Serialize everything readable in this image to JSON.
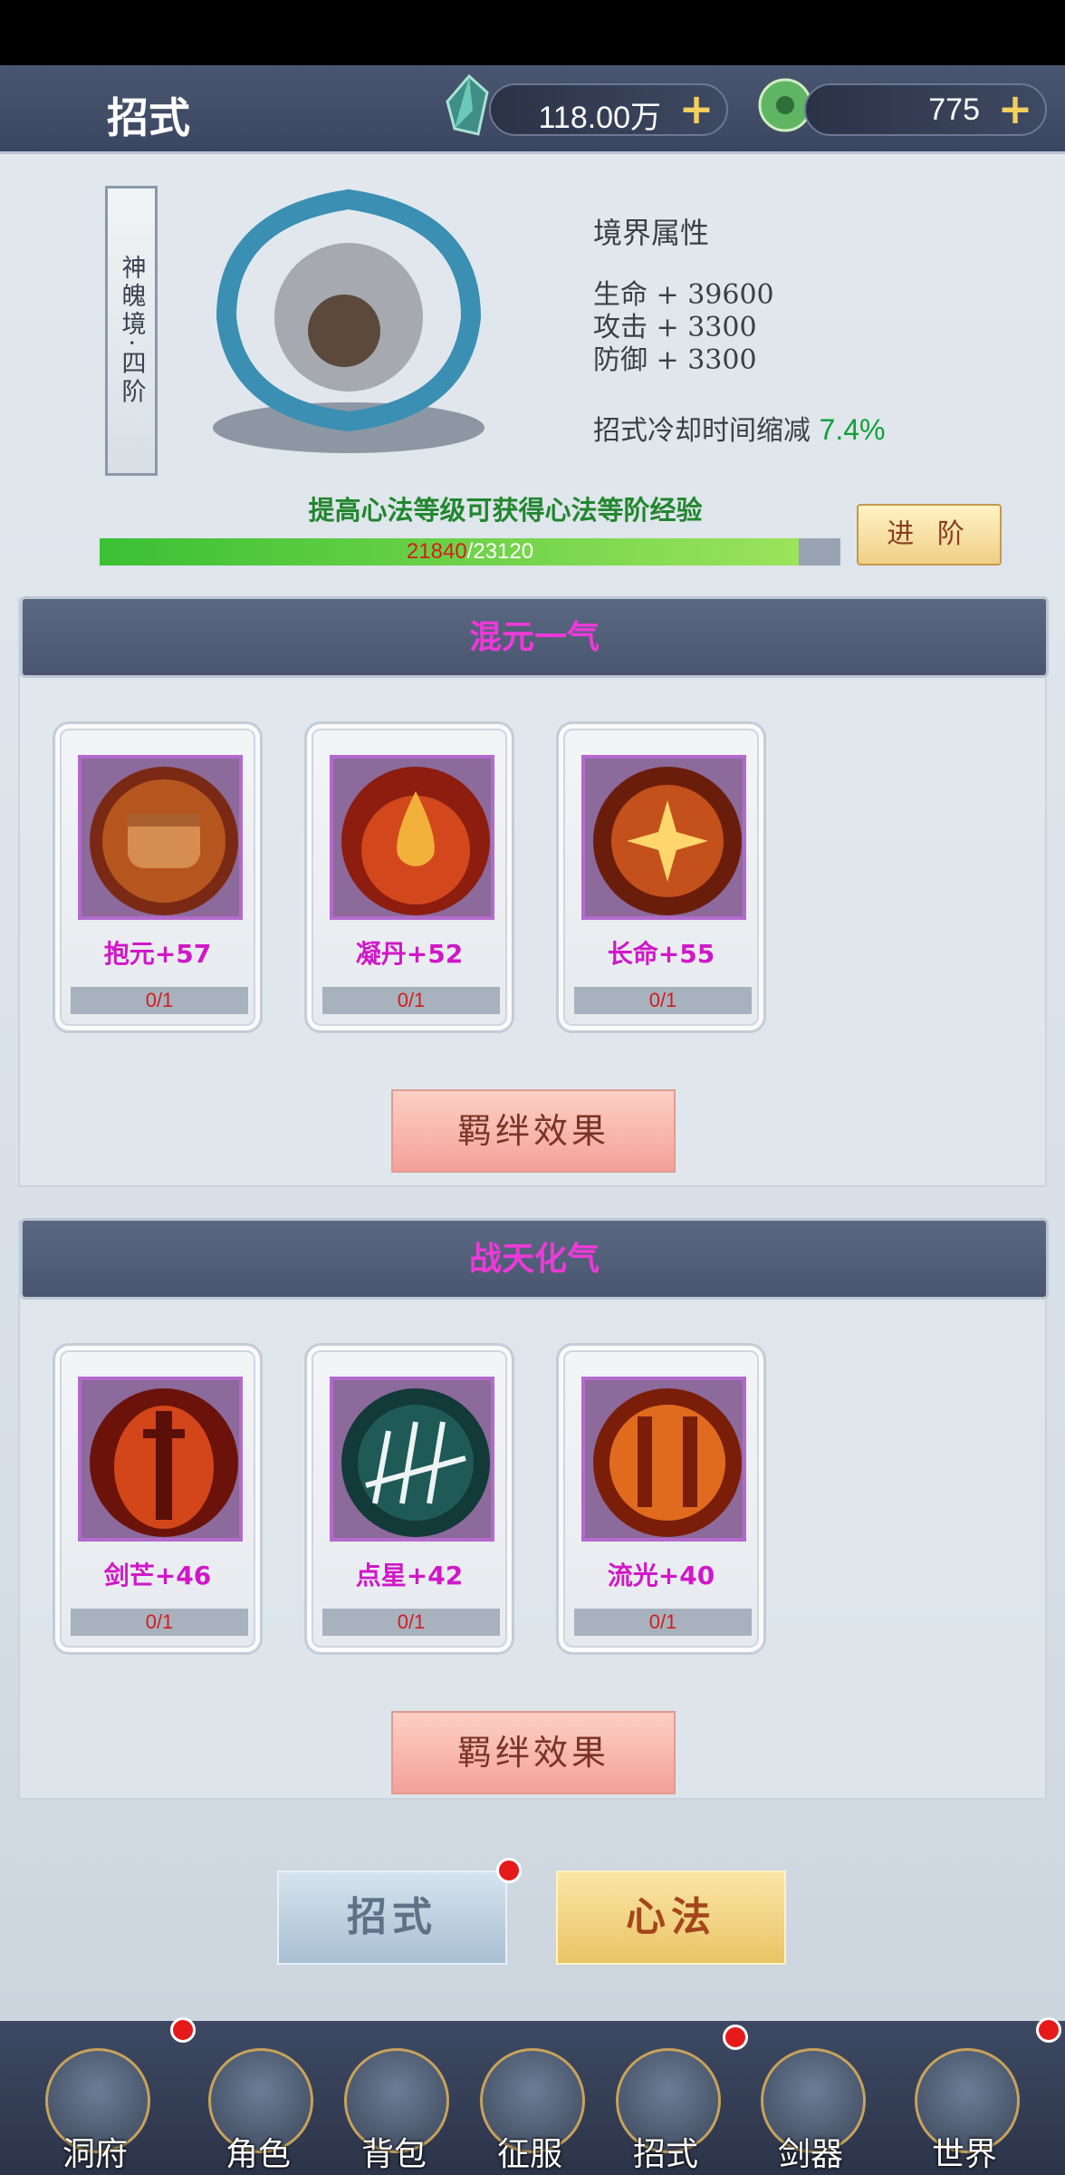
{
  "header": {
    "title": "招式",
    "currency1": {
      "value": "118.00万",
      "icon": "crystal-icon"
    },
    "currency2": {
      "value": "775",
      "icon": "jade-icon"
    }
  },
  "realm": {
    "badge": "神魄境·四阶",
    "attr_title": "境界属性",
    "attrs": [
      {
        "text": "生命 + 39600"
      },
      {
        "text": "攻击 + 3300"
      },
      {
        "text": "防御 + 3300"
      }
    ],
    "cd_label": "招式冷却时间缩减",
    "cd_value": "7.4%",
    "exp_hint": "提高心法等级可获得心法等阶经验",
    "exp_current": "21840",
    "exp_total": "/23120",
    "exp_fraction": 0.944,
    "advance_label": "进 阶"
  },
  "sections": [
    {
      "title": "混元一气",
      "cards": [
        {
          "label": "抱元+57",
          "count": "0/1",
          "icon": "fist-icon"
        },
        {
          "label": "凝丹+52",
          "count": "0/1",
          "icon": "drop-icon"
        },
        {
          "label": "长命+55",
          "count": "0/1",
          "icon": "burst-icon"
        }
      ],
      "bond_label": "羁绊效果"
    },
    {
      "title": "战天化气",
      "cards": [
        {
          "label": "剑芒+46",
          "count": "0/1",
          "icon": "sword-icon"
        },
        {
          "label": "点星+42",
          "count": "0/1",
          "icon": "slash-icon"
        },
        {
          "label": "流光+40",
          "count": "0/1",
          "icon": "twin-swords-icon"
        }
      ],
      "bond_label": "羁绊效果"
    }
  ],
  "tabs": {
    "moves": "招式",
    "method": "心法"
  },
  "nav": [
    {
      "label": "洞府",
      "icon": "cave-house-icon"
    },
    {
      "label": "角色",
      "icon": "character-icon"
    },
    {
      "label": "背包",
      "icon": "bag-icon"
    },
    {
      "label": "征服",
      "icon": "crossed-swords-icon"
    },
    {
      "label": "招式",
      "icon": "scroll-icon"
    },
    {
      "label": "剑器",
      "icon": "sword-artifact-icon"
    },
    {
      "label": "世界",
      "icon": "world-map-icon"
    }
  ],
  "colors": {
    "accent_title": "#ee39d9",
    "green": "#129f3a",
    "red_badge": "#e61a1a"
  }
}
